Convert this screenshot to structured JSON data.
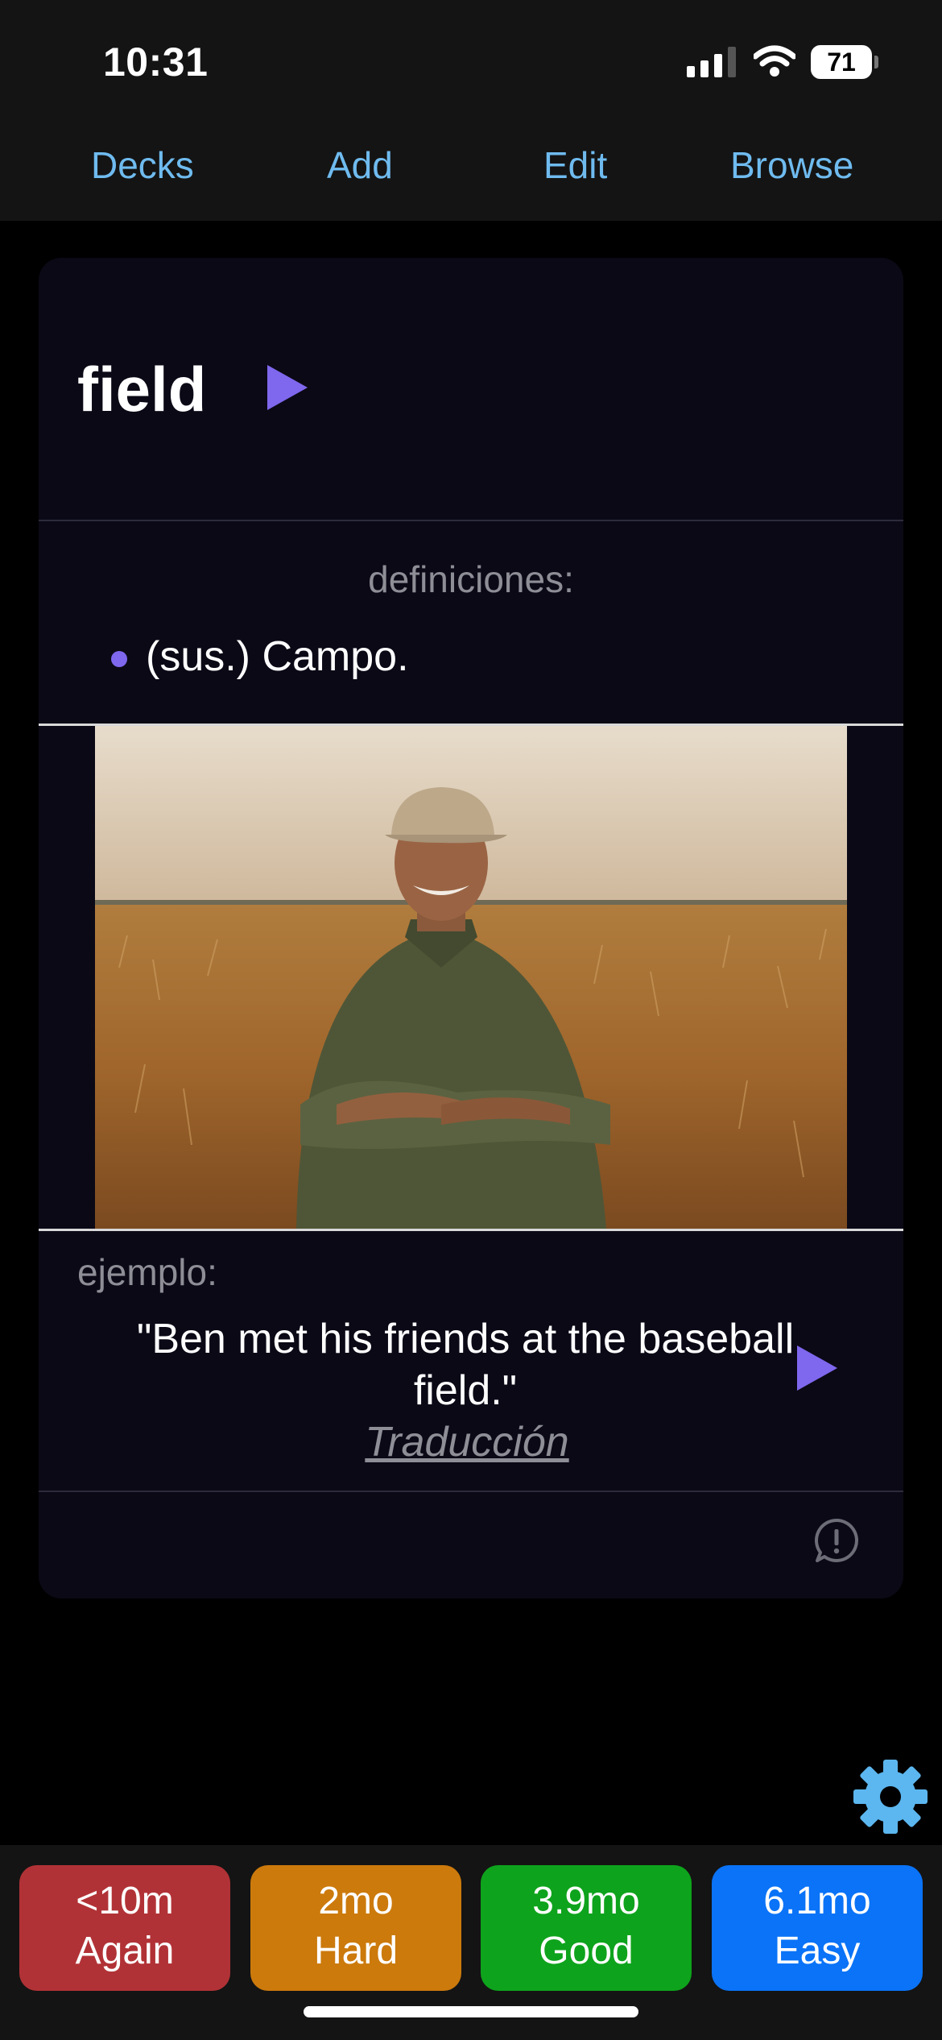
{
  "status": {
    "time": "10:31",
    "battery": "71",
    "signal_icon": "signal-icon",
    "wifi_icon": "wifi-icon"
  },
  "nav": {
    "decks": "Decks",
    "add": "Add",
    "edit": "Edit",
    "browse": "Browse"
  },
  "card": {
    "word": "field",
    "definitions_label": "definiciones:",
    "definitions": [
      "(sus.) Campo."
    ],
    "image_description": "man-in-wheat-field-photo",
    "example_label": "ejemplo:",
    "example_text": "\"Ben met his friends at the baseball field.\"",
    "translation_link": "Traducción"
  },
  "answers": [
    {
      "interval": "<10m",
      "label": "Again",
      "color": "#b13236"
    },
    {
      "interval": "2mo",
      "label": "Hard",
      "color": "#cc7a0c"
    },
    {
      "interval": "3.9mo",
      "label": "Good",
      "color": "#0ea31c"
    },
    {
      "interval": "6.1mo",
      "label": "Easy",
      "color": "#0a73f7"
    }
  ],
  "colors": {
    "accent_nav": "#6fbbef",
    "play": "#7f67ee",
    "card_bg": "#0b0916"
  }
}
